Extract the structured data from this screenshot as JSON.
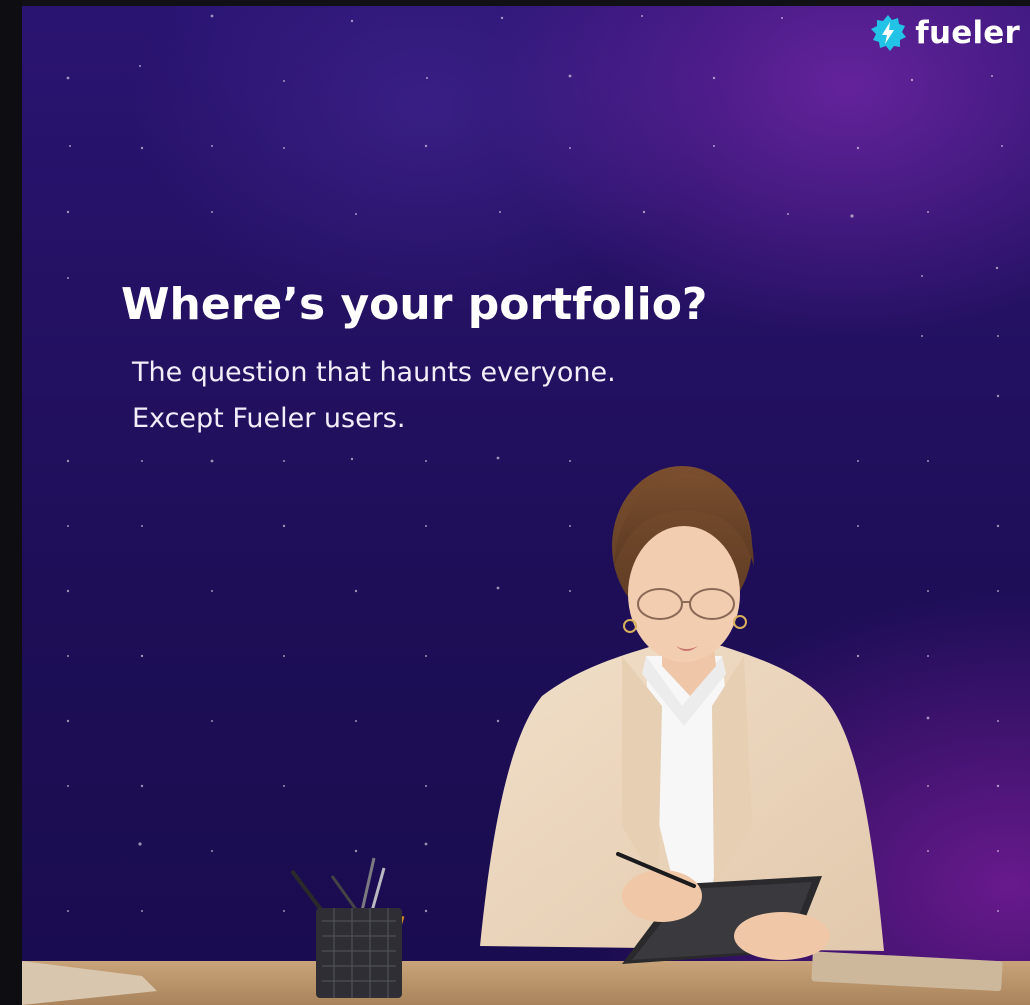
{
  "brand": {
    "name": "fueler",
    "icon": "bolt-gear-icon",
    "accent_color": "#22c3e6"
  },
  "headline": "Where’s your portfolio?",
  "subtext": {
    "line1": "The question that haunts everyone.",
    "line2": "Except Fueler users."
  },
  "photo": {
    "subject": "woman-writing-on-tablet-at-desk",
    "pencil_cup": "pencil-holder"
  },
  "colors": {
    "background_top": "#2a1472",
    "background_bottom": "#1a0c4f",
    "glow": "#8a2bb0",
    "text": "#ffffff"
  }
}
